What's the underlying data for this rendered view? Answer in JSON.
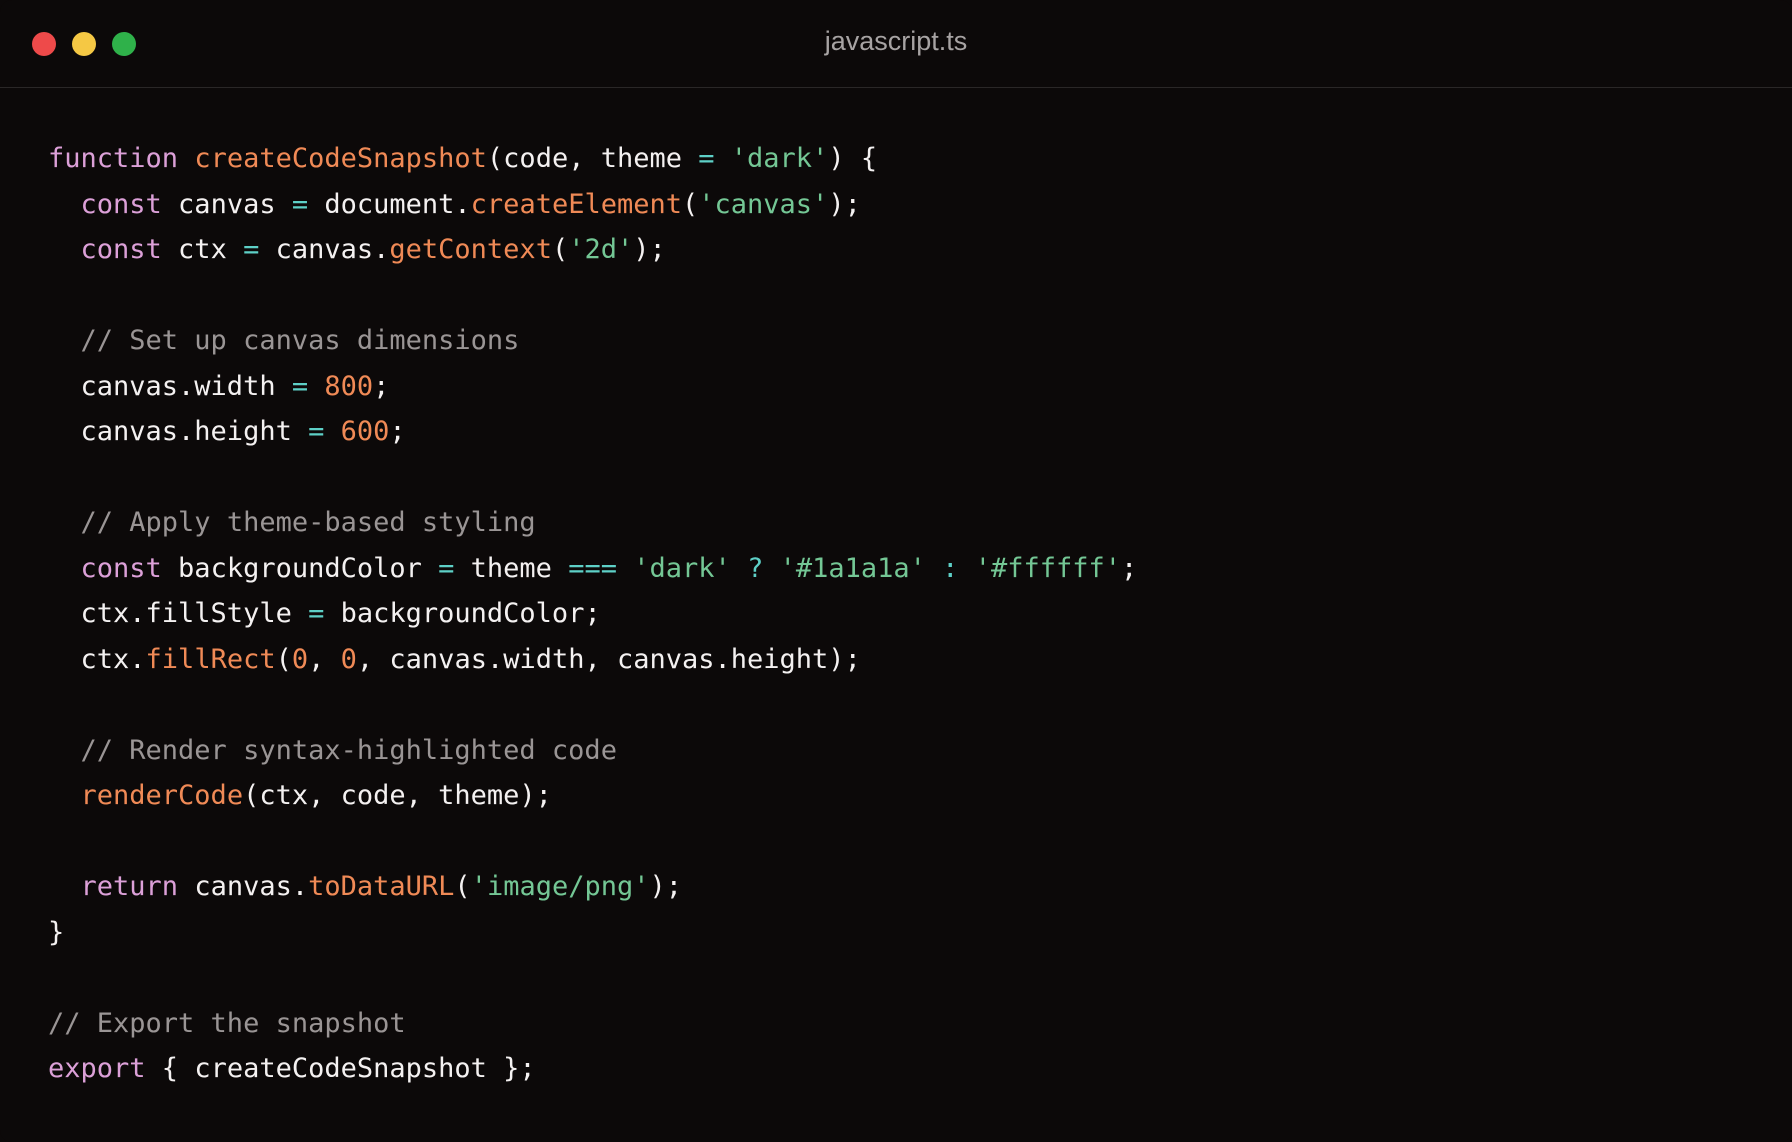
{
  "window": {
    "title": "javascript.ts",
    "controls": [
      "close",
      "minimize",
      "maximize"
    ]
  },
  "code": {
    "lines": [
      [
        {
          "t": "kw",
          "v": "function"
        },
        {
          "t": "id",
          "v": " "
        },
        {
          "t": "fn",
          "v": "createCodeSnapshot"
        },
        {
          "t": "id",
          "v": "(code, theme "
        },
        {
          "t": "op",
          "v": "="
        },
        {
          "t": "id",
          "v": " "
        },
        {
          "t": "str",
          "v": "'dark'"
        },
        {
          "t": "id",
          "v": ") {"
        }
      ],
      [
        {
          "t": "id",
          "v": "  "
        },
        {
          "t": "kw",
          "v": "const"
        },
        {
          "t": "id",
          "v": " canvas "
        },
        {
          "t": "op",
          "v": "="
        },
        {
          "t": "id",
          "v": " document."
        },
        {
          "t": "fn",
          "v": "createElement"
        },
        {
          "t": "id",
          "v": "("
        },
        {
          "t": "str",
          "v": "'canvas'"
        },
        {
          "t": "id",
          "v": ");"
        }
      ],
      [
        {
          "t": "id",
          "v": "  "
        },
        {
          "t": "kw",
          "v": "const"
        },
        {
          "t": "id",
          "v": " ctx "
        },
        {
          "t": "op",
          "v": "="
        },
        {
          "t": "id",
          "v": " canvas."
        },
        {
          "t": "fn",
          "v": "getContext"
        },
        {
          "t": "id",
          "v": "("
        },
        {
          "t": "str",
          "v": "'2d'"
        },
        {
          "t": "id",
          "v": ");"
        }
      ],
      [],
      [
        {
          "t": "id",
          "v": "  "
        },
        {
          "t": "cm",
          "v": "// Set up canvas dimensions"
        }
      ],
      [
        {
          "t": "id",
          "v": "  canvas.width "
        },
        {
          "t": "op",
          "v": "="
        },
        {
          "t": "id",
          "v": " "
        },
        {
          "t": "num",
          "v": "800"
        },
        {
          "t": "id",
          "v": ";"
        }
      ],
      [
        {
          "t": "id",
          "v": "  canvas.height "
        },
        {
          "t": "op",
          "v": "="
        },
        {
          "t": "id",
          "v": " "
        },
        {
          "t": "num",
          "v": "600"
        },
        {
          "t": "id",
          "v": ";"
        }
      ],
      [],
      [
        {
          "t": "id",
          "v": "  "
        },
        {
          "t": "cm",
          "v": "// Apply theme-based styling"
        }
      ],
      [
        {
          "t": "id",
          "v": "  "
        },
        {
          "t": "kw",
          "v": "const"
        },
        {
          "t": "id",
          "v": " backgroundColor "
        },
        {
          "t": "op",
          "v": "="
        },
        {
          "t": "id",
          "v": " theme "
        },
        {
          "t": "op",
          "v": "==="
        },
        {
          "t": "id",
          "v": " "
        },
        {
          "t": "str",
          "v": "'dark'"
        },
        {
          "t": "id",
          "v": " "
        },
        {
          "t": "op",
          "v": "?"
        },
        {
          "t": "id",
          "v": " "
        },
        {
          "t": "str",
          "v": "'#1a1a1a'"
        },
        {
          "t": "id",
          "v": " "
        },
        {
          "t": "op",
          "v": ":"
        },
        {
          "t": "id",
          "v": " "
        },
        {
          "t": "str",
          "v": "'#ffffff'"
        },
        {
          "t": "id",
          "v": ";"
        }
      ],
      [
        {
          "t": "id",
          "v": "  ctx.fillStyle "
        },
        {
          "t": "op",
          "v": "="
        },
        {
          "t": "id",
          "v": " backgroundColor;"
        }
      ],
      [
        {
          "t": "id",
          "v": "  ctx."
        },
        {
          "t": "fn",
          "v": "fillRect"
        },
        {
          "t": "id",
          "v": "("
        },
        {
          "t": "num",
          "v": "0"
        },
        {
          "t": "id",
          "v": ", "
        },
        {
          "t": "num",
          "v": "0"
        },
        {
          "t": "id",
          "v": ", canvas.width, canvas.height);"
        }
      ],
      [],
      [
        {
          "t": "id",
          "v": "  "
        },
        {
          "t": "cm",
          "v": "// Render syntax-highlighted code"
        }
      ],
      [
        {
          "t": "id",
          "v": "  "
        },
        {
          "t": "fn",
          "v": "renderCode"
        },
        {
          "t": "id",
          "v": "(ctx, code, theme);"
        }
      ],
      [],
      [
        {
          "t": "id",
          "v": "  "
        },
        {
          "t": "kw",
          "v": "return"
        },
        {
          "t": "id",
          "v": " canvas."
        },
        {
          "t": "fn",
          "v": "toDataURL"
        },
        {
          "t": "id",
          "v": "("
        },
        {
          "t": "str",
          "v": "'image/png'"
        },
        {
          "t": "id",
          "v": ");"
        }
      ],
      [
        {
          "t": "id",
          "v": "}"
        }
      ],
      [],
      [
        {
          "t": "cm",
          "v": "// Export the snapshot"
        }
      ],
      [
        {
          "t": "kw",
          "v": "export"
        },
        {
          "t": "id",
          "v": " { createCodeSnapshot };"
        }
      ]
    ]
  },
  "colors": {
    "background": "#0c0909",
    "keyword": "#dca0d8",
    "function": "#f08a56",
    "string": "#74c795",
    "number": "#f08a56",
    "operator": "#5ed0c7",
    "comment": "#9a9595",
    "text": "#f4f1f1"
  }
}
